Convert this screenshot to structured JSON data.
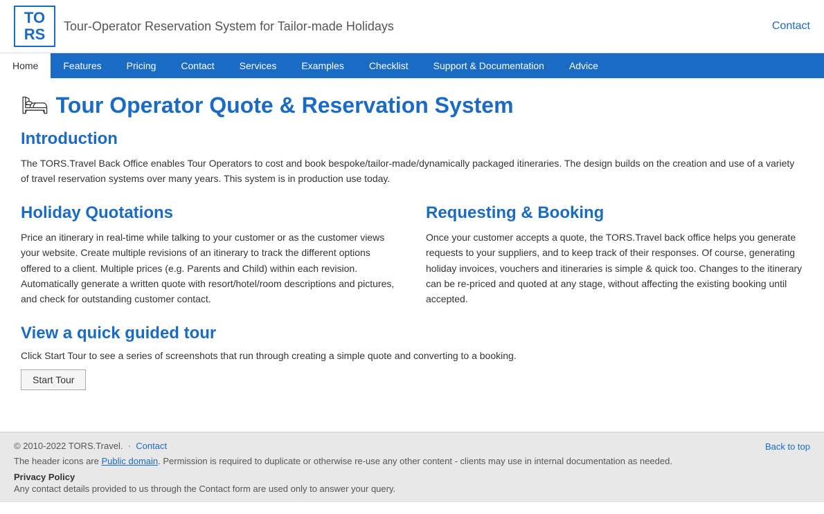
{
  "header": {
    "logo_top": "TO",
    "logo_bottom": "RS",
    "tagline": "Tour-Operator Reservation System for Tailor-made Holidays",
    "contact_label": "Contact"
  },
  "nav": {
    "items": [
      {
        "label": "Home",
        "active": true
      },
      {
        "label": "Features",
        "active": false
      },
      {
        "label": "Pricing",
        "active": false
      },
      {
        "label": "Contact",
        "active": false
      },
      {
        "label": "Services",
        "active": false
      },
      {
        "label": "Examples",
        "active": false
      },
      {
        "label": "Checklist",
        "active": false
      },
      {
        "label": "Support & Documentation",
        "active": false
      },
      {
        "label": "Advice",
        "active": false
      }
    ]
  },
  "main": {
    "page_title": "Tour Operator Quote & Reservation System",
    "page_title_icon": "🛏",
    "introduction": {
      "heading": "Introduction",
      "text": "The TORS.Travel Back Office enables Tour Operators to cost and book bespoke/tailor-made/dynamically packaged itineraries. The design builds on the creation and use of a variety of travel reservation systems over many years. This system is in production use today."
    },
    "holiday_quotations": {
      "heading": "Holiday Quotations",
      "text": "Price an itinerary in real-time while talking to your customer or as the customer views your website. Create multiple revisions of an itinerary to track the different options offered to a client. Multiple prices (e.g. Parents and Child) within each revision. Automatically generate a written quote with resort/hotel/room descriptions and pictures, and check for outstanding customer contact."
    },
    "requesting_booking": {
      "heading": "Requesting & Booking",
      "text": "Once your customer accepts a quote, the TORS.Travel back office helps you generate requests to your suppliers, and to keep track of their responses. Of course, generating holiday invoices, vouchers and itineraries is simple & quick too. Changes to the itinerary can be re-priced and quoted at any stage, without affecting the existing booking until accepted."
    },
    "guided_tour": {
      "heading": "View a quick guided tour",
      "description": "Click Start Tour to see a series of screenshots that run through creating a simple quote and converting to a booking.",
      "button_label": "Start Tour"
    }
  },
  "footer": {
    "copyright": "© 2010-2022 TORS.Travel.",
    "contact_label": "Contact",
    "back_to_top": "Back to top",
    "icons_text": "The header icons are ",
    "public_domain_label": "Public domain",
    "icons_text2": ". Permission is required to duplicate or otherwise re-use any other content - clients may use in internal documentation as needed.",
    "privacy_title": "Privacy Policy",
    "privacy_text": "Any contact details provided to us through the Contact form are used only to answer your query."
  }
}
